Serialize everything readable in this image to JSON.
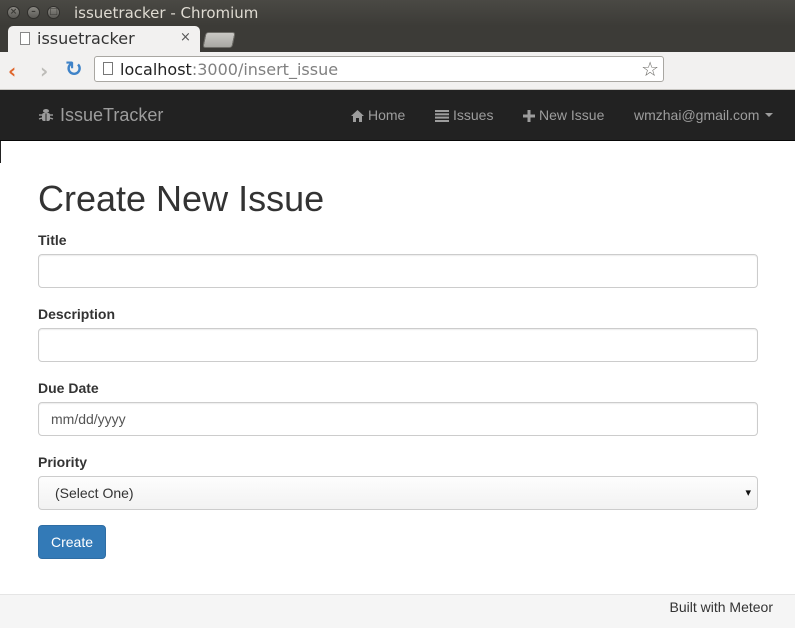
{
  "window": {
    "title": "issuetracker - Chromium",
    "close_glyph": "×",
    "minimize_glyph": "–",
    "maximize_glyph": "□"
  },
  "tab": {
    "title": "issuetracker",
    "close_glyph": "×"
  },
  "toolbar": {
    "back_glyph": "‹",
    "forward_glyph": "›",
    "reload_glyph": "↻",
    "url_host": "localhost",
    "url_path": ":3000/insert_issue",
    "star_glyph": "☆"
  },
  "navbar": {
    "brand": "IssueTracker",
    "items": [
      {
        "label": "Home",
        "icon": "home-icon"
      },
      {
        "label": "Issues",
        "icon": "list-icon"
      },
      {
        "label": "New Issue",
        "icon": "plus-icon"
      }
    ],
    "user": "wmzhai@gmail.com"
  },
  "form": {
    "heading": "Create New Issue",
    "title_label": "Title",
    "title_value": "",
    "description_label": "Description",
    "description_value": "",
    "due_date_label": "Due Date",
    "due_date_placeholder": "mm/dd/yyyy",
    "priority_label": "Priority",
    "priority_selected": "(Select One)",
    "select_arrow": "▾",
    "submit_label": "Create"
  },
  "footer": {
    "text": "Built with Meteor"
  },
  "colors": {
    "navbar_bg": "#222222",
    "nav_text": "#9d9d9d",
    "primary_button": "#337ab7",
    "footer_bg": "#f5f5f5"
  }
}
